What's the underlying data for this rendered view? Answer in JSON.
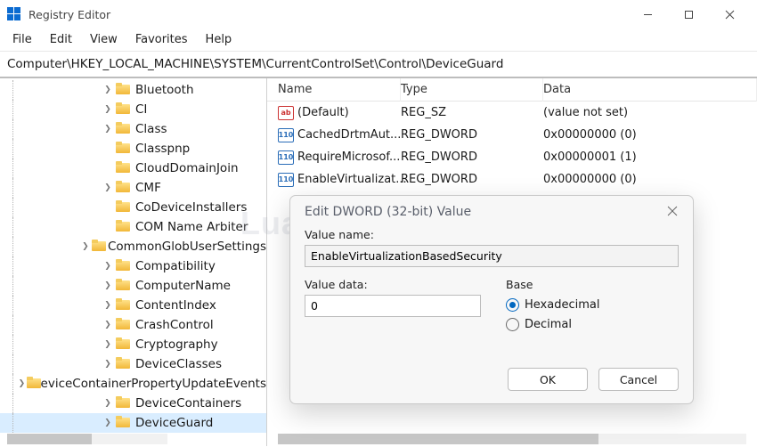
{
  "app": {
    "title": "Registry Editor"
  },
  "menu": {
    "file": "File",
    "edit": "Edit",
    "view": "View",
    "favorites": "Favorites",
    "help": "Help"
  },
  "address": "Computer\\HKEY_LOCAL_MACHINE\\SYSTEM\\CurrentControlSet\\Control\\DeviceGuard",
  "tree": {
    "items": [
      {
        "label": "Bluetooth",
        "expandable": true
      },
      {
        "label": "CI",
        "expandable": true
      },
      {
        "label": "Class",
        "expandable": true
      },
      {
        "label": "Classpnp",
        "expandable": false
      },
      {
        "label": "CloudDomainJoin",
        "expandable": false
      },
      {
        "label": "CMF",
        "expandable": true
      },
      {
        "label": "CoDeviceInstallers",
        "expandable": false
      },
      {
        "label": "COM Name Arbiter",
        "expandable": false
      },
      {
        "label": "CommonGlobUserSettings",
        "expandable": true
      },
      {
        "label": "Compatibility",
        "expandable": true
      },
      {
        "label": "ComputerName",
        "expandable": true
      },
      {
        "label": "ContentIndex",
        "expandable": true
      },
      {
        "label": "CrashControl",
        "expandable": true
      },
      {
        "label": "Cryptography",
        "expandable": true
      },
      {
        "label": "DeviceClasses",
        "expandable": true
      },
      {
        "label": "DeviceContainerPropertyUpdateEvents",
        "expandable": true
      },
      {
        "label": "DeviceContainers",
        "expandable": true
      },
      {
        "label": "DeviceGuard",
        "expandable": true,
        "selected": true
      }
    ]
  },
  "list": {
    "headers": {
      "name": "Name",
      "type": "Type",
      "data": "Data"
    },
    "rows": [
      {
        "icon": "sz",
        "name": "(Default)",
        "type": "REG_SZ",
        "data": "(value not set)"
      },
      {
        "icon": "dw",
        "name": "CachedDrtmAut...",
        "type": "REG_DWORD",
        "data": "0x00000000 (0)"
      },
      {
        "icon": "dw",
        "name": "RequireMicrosof...",
        "type": "REG_DWORD",
        "data": "0x00000001 (1)"
      },
      {
        "icon": "dw",
        "name": "EnableVirtualizat...",
        "type": "REG_DWORD",
        "data": "0x00000000 (0)"
      }
    ]
  },
  "dialog": {
    "title": "Edit DWORD (32-bit) Value",
    "value_name_label": "Value name:",
    "value_name": "EnableVirtualizationBasedSecurity",
    "value_data_label": "Value data:",
    "value_data": "0",
    "base_label": "Base",
    "hexadecimal": "Hexadecimal",
    "decimal": "Decimal",
    "selected_base": "hexadecimal",
    "ok": "OK",
    "cancel": "Cancel"
  },
  "watermark": "Luantrimang."
}
